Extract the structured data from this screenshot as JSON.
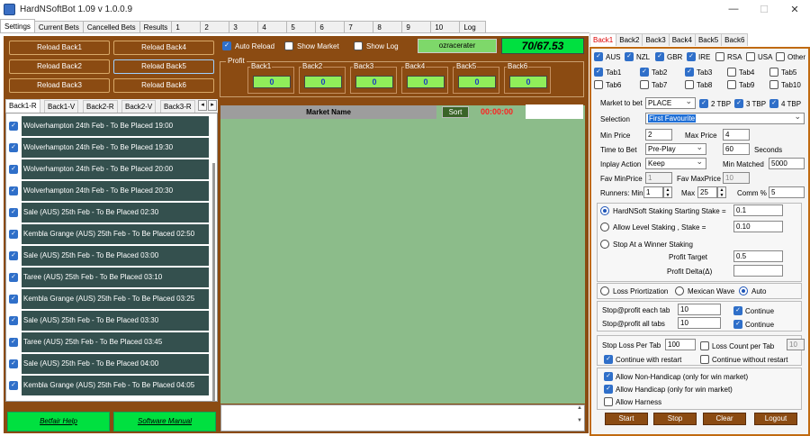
{
  "window": {
    "title": "HardNSoftBot 1.09 v 1.0.0.9",
    "minimize": "—",
    "maximize": "☐",
    "close": "✕"
  },
  "tabs": [
    "Settings",
    "Current Bets",
    "Cancelled Bets",
    "Results",
    "1",
    "2",
    "3",
    "4",
    "5",
    "6",
    "7",
    "8",
    "9",
    "10",
    "Log"
  ],
  "reload_buttons": [
    "Reload Back1",
    "Reload Back4",
    "Reload Back2",
    "Reload Back5",
    "Reload Back3",
    "Reload Back6"
  ],
  "back_tabs": [
    "Back1-R",
    "Back1-V",
    "Back2-R",
    "Back2-V",
    "Back3-R"
  ],
  "arrows": {
    "left": "◂",
    "right": "▸",
    "up": "▲",
    "down": "▼"
  },
  "races": [
    "Wolverhampton 24th Feb - To Be Placed 19:00",
    "Wolverhampton 24th Feb - To Be Placed 19:30",
    "Wolverhampton 24th Feb - To Be Placed 20:00",
    "Wolverhampton 24th Feb - To Be Placed 20:30",
    "Sale (AUS) 25th Feb - To Be Placed 02:30",
    "Kembla Grange (AUS) 25th Feb - To Be Placed 02:50",
    "Sale (AUS) 25th Feb - To Be Placed 03:00",
    "Taree (AUS) 25th Feb - To Be Placed 03:10",
    "Kembla Grange (AUS) 25th Feb - To Be Placed 03:25",
    "Sale (AUS) 25th Feb - To Be Placed 03:30",
    "Taree (AUS) 25th Feb - To Be Placed 03:45",
    "Sale (AUS) 25th Feb - To Be Placed 04:00",
    "Kembla Grange (AUS) 25th Feb - To Be Placed 04:05"
  ],
  "help_buttons": {
    "betfair": "Betfair Help",
    "manual": "Software Manual"
  },
  "top": {
    "auto_reload": "Auto Reload",
    "show_market": "Show Market",
    "show_log": "Show Log",
    "username": "ozracerater",
    "ratio": "70/67.53"
  },
  "profit": {
    "label": "Profit",
    "cols": [
      {
        "name": "Back1",
        "value": "0"
      },
      {
        "name": "Back2",
        "value": "0"
      },
      {
        "name": "Back3",
        "value": "0"
      },
      {
        "name": "Back4",
        "value": "0"
      },
      {
        "name": "Back5",
        "value": "0"
      },
      {
        "name": "Back6",
        "value": "0"
      }
    ]
  },
  "market": {
    "header": "Market Name",
    "sort": "Sort",
    "timer": "00:00:00"
  },
  "right_tabs": [
    "Back1",
    "Back2",
    "Back3",
    "Back4",
    "Back5",
    "Back6"
  ],
  "countries": [
    "AUS",
    "NZL",
    "GBR",
    "IRE",
    "RSA",
    "USA",
    "Other"
  ],
  "tab_checks": [
    "Tab1",
    "Tab2",
    "Tab3",
    "Tab4",
    "Tab5",
    "Tab6",
    "Tab7",
    "Tab8",
    "Tab9",
    "Tab10"
  ],
  "settings": {
    "market_to_bet_label": "Market to bet",
    "market_to_bet": "PLACE",
    "tbp": [
      "2 TBP",
      "3 TBP",
      "4 TBP"
    ],
    "selection_label": "Selection",
    "selection": "First Favourite",
    "min_price_label": "Min Price",
    "min_price": "2",
    "max_price_label": "Max Price",
    "max_price": "4",
    "time_to_bet_label": "Time to Bet",
    "time_to_bet": "Pre-Play",
    "seconds": "60",
    "seconds_label": "Seconds",
    "inplay_label": "Inplay Action",
    "inplay": "Keep",
    "min_matched_label": "Min Matched",
    "min_matched": "5000",
    "fav_min_label": "Fav MinPrice",
    "fav_min": "1",
    "fav_max_label": "Fav MaxPrice",
    "fav_max": "10",
    "runners_label": "Runners: Min",
    "runners_min": "1",
    "runners_max_label": "Max",
    "runners_max": "25",
    "comm_label": "Comm %",
    "comm": "5"
  },
  "staking": {
    "hardnsoft": "HardNSoft Staking Starting Stake =",
    "hardnsoft_val": "0.1",
    "level": "Allow Level Staking , Stake =",
    "level_val": "0.10",
    "stop_winner": "Stop At a Winner Staking",
    "profit_target_label": "Profit Target",
    "profit_target": "0.5",
    "profit_delta_label": "Profit Delta(Δ)",
    "profit_delta": ""
  },
  "prioritization": [
    "Loss Priortization",
    "Mexican Wave",
    "Auto"
  ],
  "stops": {
    "each_label": "Stop@profit each tab",
    "each": "10",
    "all_label": "Stop@profit all tabs",
    "all": "10",
    "continue": "Continue",
    "loss_label": "Stop Loss Per Tab",
    "loss": "100",
    "loss_count": "Loss Count per Tab",
    "loss_count_val": "10",
    "cont_restart": "Continue with restart",
    "cont_norestart": "Continue without restart"
  },
  "filters": [
    "Allow Non-Handicap (only for win market)",
    "Allow Handicap (only for win market)",
    "Allow Harness"
  ],
  "actions": [
    "Start",
    "Stop",
    "Clear",
    "Logout"
  ]
}
